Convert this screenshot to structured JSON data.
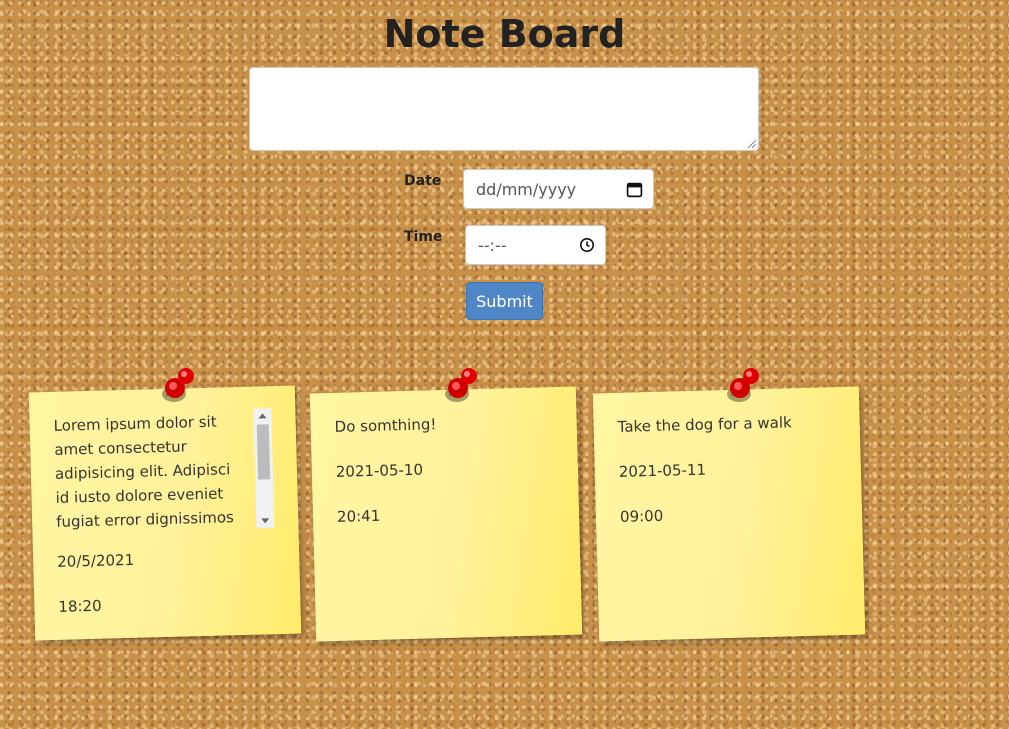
{
  "header": {
    "title": "Note Board"
  },
  "form": {
    "note_value": "",
    "date_label": "Date",
    "date_placeholder": "dd/mm/yyyy",
    "time_label": "Time",
    "time_placeholder": "--:--",
    "submit_label": "Submit"
  },
  "notes": [
    {
      "text": "Lorem ipsum dolor sit amet consectetur adipisicing elit. Adipisci id iusto dolore eveniet fugiat error dignissimos soluta sed iure",
      "date": "20/5/2021",
      "time": "18:20"
    },
    {
      "text": "Do somthing!",
      "date": "2021-05-10",
      "time": "20:41"
    },
    {
      "text": "Take the dog for a walk",
      "date": "2021-05-11",
      "time": "09:00"
    }
  ],
  "icons": {
    "date": "calendar-icon",
    "time": "clock-icon",
    "pin": "pushpin-icon"
  },
  "colors": {
    "accent": "#4f86c6",
    "note": "#fff29a",
    "cork": "#c8914a",
    "pin": "#e00000"
  }
}
